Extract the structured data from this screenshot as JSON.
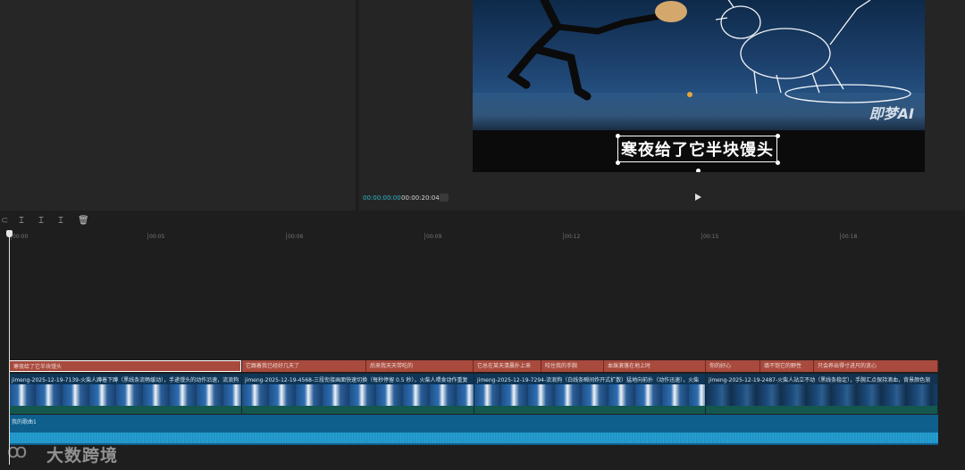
{
  "player": {
    "caption": "寒夜给了它半块馒头",
    "watermark": "即梦AI",
    "time_current": "00:00:00:00",
    "time_total": "00:00:20:04"
  },
  "toolbar": {
    "undo_icon": "undo-icon",
    "split_icon": "split-icon",
    "split_left_icon": "split-left-icon",
    "split_right_icon": "split-right-icon",
    "delete_icon": "trash-icon"
  },
  "ruler": {
    "labels": [
      "00:00",
      "00:05",
      "00:06",
      "00:09",
      "00:12",
      "00:15",
      "00:18"
    ]
  },
  "text_track": {
    "clips": [
      {
        "label": "寒夜给了它半块馒头"
      },
      {
        "label": "它跟着我已经好几天了"
      },
      {
        "label": "后来我天天带吃的"
      },
      {
        "label": "它总在某天清晨扑上来"
      },
      {
        "label": "咬住我的手腕"
      },
      {
        "label": "血珠滚落在地上时"
      },
      {
        "label": "你的好心"
      },
      {
        "label": "填不饱它的野性"
      },
      {
        "label": "只会养出得寸进尺的贪心"
      }
    ]
  },
  "video_track": {
    "clips": [
      {
        "label": "jimeng-2025-12-19-7139-火柴人蹲着下蹲（黑线条流畅缓动），手递馒头的动作沿速，流浪狗"
      },
      {
        "label": "jimeng-2025-12-19-4568-三段衔接画面快速切换（每秒停留 0.5 秒），火柴人喂食动作重复"
      },
      {
        "label": "jimeng-2025-12-19-7294-流浪狗（白线条瞬间炸开式扩散）猛地向前扑（动作迅速），火柴"
      },
      {
        "label": "jimeng-2025-12-19-2487-火柴人站立不动（黑线条稳定），手腕汇点保持滴血，背景颜色渐"
      }
    ]
  },
  "audio_track": {
    "label": "我的歌曲1"
  },
  "branding": {
    "text": "大数跨境"
  }
}
